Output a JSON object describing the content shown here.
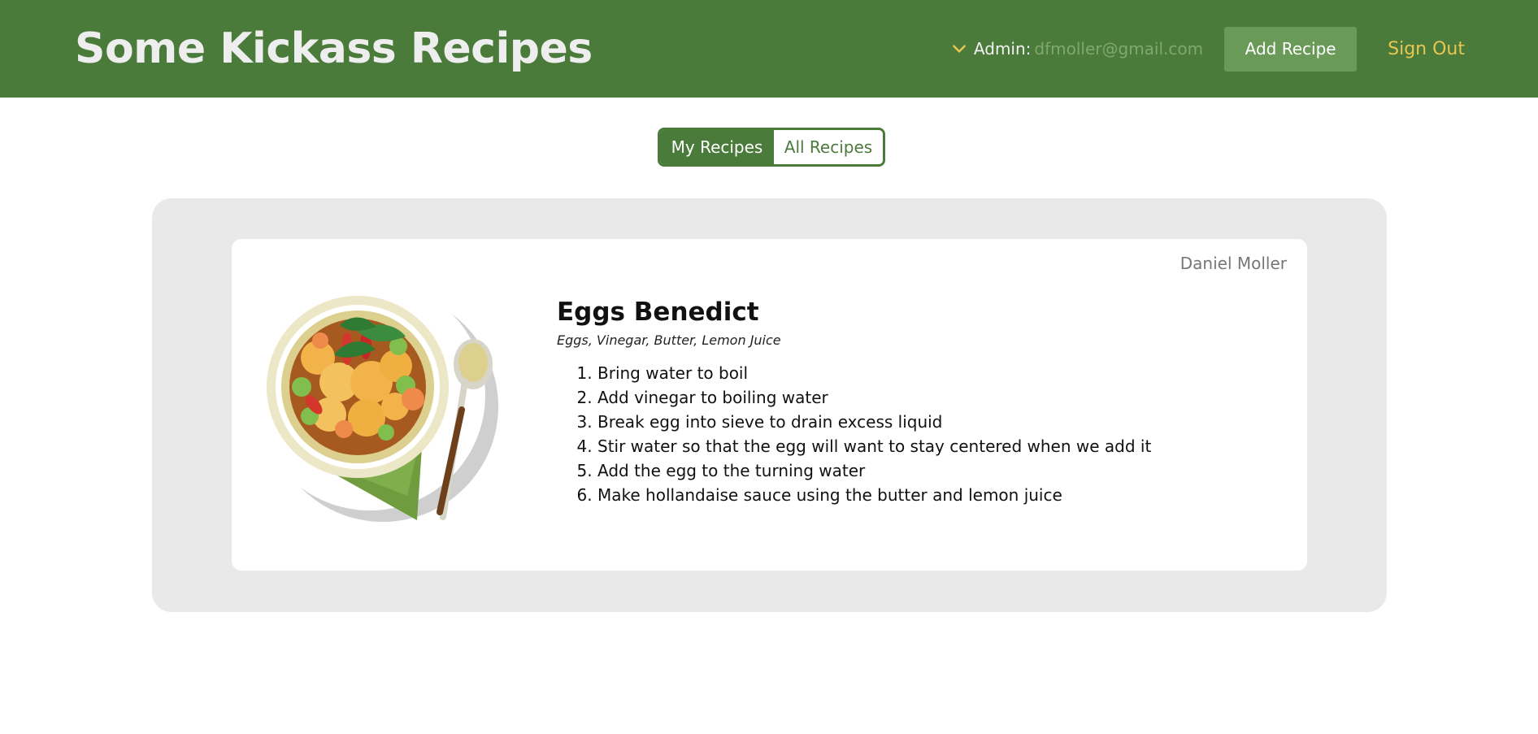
{
  "header": {
    "title": "Some Kickass Recipes",
    "admin_label": "Admin:",
    "admin_email": "dfmoller@gmail.com",
    "add_recipe_label": "Add Recipe",
    "sign_out_label": "Sign Out",
    "chevron_icon": "chevron-down-icon"
  },
  "tabs": [
    {
      "label": "My Recipes",
      "active": true
    },
    {
      "label": "All Recipes",
      "active": false
    }
  ],
  "recipe": {
    "author": "Daniel Moller",
    "title": "Eggs Benedict",
    "ingredients": "Eggs, Vinegar, Butter, Lemon Juice",
    "steps": [
      "Bring water to boil",
      "Add vinegar to boiling water",
      "Break egg into sieve to drain excess liquid",
      "Stir water so that the egg will want to stay centered when we add it",
      "Add the egg to the turning water",
      "Make hollandaise sauce using the butter and lemon juice"
    ],
    "image_icon": "food-bowl-illustration"
  },
  "colors": {
    "header_green": "#4b7b3a",
    "button_green": "#6a9a58",
    "accent_gold": "#e7c651",
    "panel_gray": "#e9e9e9"
  }
}
